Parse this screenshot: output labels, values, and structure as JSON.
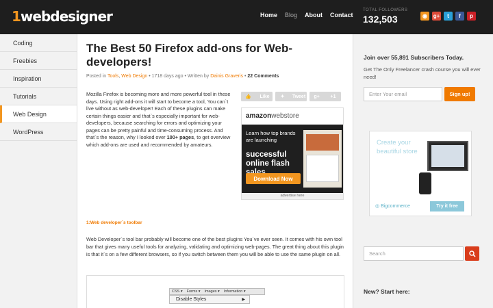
{
  "header": {
    "logo_one": "1",
    "logo_rest": "webdesigner",
    "nav": [
      "Home",
      "Blog",
      "About",
      "Contact"
    ],
    "followers_label": "TOTAL FOLLOWERS",
    "followers_count": "132,503",
    "social": [
      {
        "icon": "rss-icon",
        "glyph": "◉",
        "color": "#f29620"
      },
      {
        "icon": "google-plus-icon",
        "glyph": "g+",
        "color": "#dd4b39"
      },
      {
        "icon": "twitter-icon",
        "glyph": "t",
        "color": "#2aa0d8"
      },
      {
        "icon": "facebook-icon",
        "glyph": "f",
        "color": "#3b5998"
      },
      {
        "icon": "pinterest-icon",
        "glyph": "p",
        "color": "#cb2027"
      }
    ]
  },
  "leftnav": [
    "Coding",
    "Freebies",
    "Inspiration",
    "Tutorials",
    "Web Design",
    "WordPress"
  ],
  "article": {
    "title": "The Best 50 Firefox add-ons for Web-developers!",
    "meta_posted": "Posted in ",
    "meta_cat1": "Tools",
    "meta_cat2": "Web Design",
    "meta_ago": " • 1718 days ago • Written by ",
    "meta_author": "Dainis Graveris",
    "meta_comments": "22 Comments",
    "intro_before": "Mozilla Firefox is becoming more and more powerful tool in these days. Using right add-ons it will start to become a tool, You can`t live without as web-developer! Each of these plugins can make certain things easier and that`s especially important for web-developers, because searching for errors and optimizing your pages can be pretty painful and time-consuming process. And that`s the reason, why I looked over ",
    "intro_bold": "100+ pages",
    "intro_after": ", to get overview which add-ons are used and recommended by amateurs.",
    "share": [
      "Like",
      "Tweet",
      "+1"
    ],
    "subhead": "1:Web developer`s toolbar",
    "para": "Web Developer`s tool bar probably will become one of the best plugins You`ve ever seen. It comes with his own tool bar that gives many useful tools for analyzing, validating and optimizing web-pages. The great thing about this plugin is that it`s on a few different browsers, so if you switch between them you will be able to use the same plugin on all.",
    "toolbar": [
      "CSS ▾",
      "Forms ▾",
      "Images ▾",
      "Information ▾"
    ],
    "dropdown_item": "Disable Styles",
    "dropdown_arrow": "▶"
  },
  "ad": {
    "brand": "amazon",
    "brand2": "webstore",
    "line1": "Learn how top brands are launching",
    "line2": "successful online flash sales",
    "button": "Download Now",
    "footer": "advertise here"
  },
  "sidebar": {
    "subscribe_title": "Join over 55,891 Subscribers Today.",
    "subscribe_desc": "Get The Only Freelancer crash course you will ever need!",
    "email_placeholder": "Enter Your email",
    "signup": "Sign up!",
    "banner_text": "Create your beautiful store",
    "banner_logo": "Bigcommerce",
    "banner_btn": "Try it free",
    "search_placeholder": "Search",
    "start_title": "New? Start here:"
  }
}
